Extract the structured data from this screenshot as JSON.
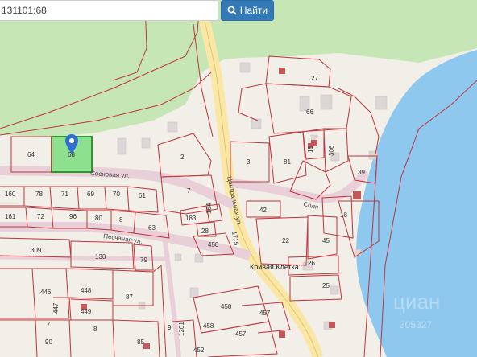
{
  "search": {
    "value": "131101:68",
    "button_label": "Найти"
  },
  "map": {
    "streets": [
      "Сосновая ул.",
      "Песчаная ул.",
      "Центральная ул.",
      "Солн",
      "Кривая Клетка"
    ],
    "parcels": [
      "64",
      "68",
      "160",
      "78",
      "71",
      "69",
      "70",
      "61",
      "161",
      "72",
      "96",
      "80",
      "8",
      "63",
      "183",
      "164",
      "28",
      "450",
      "309",
      "130",
      "79",
      "446",
      "448",
      "87",
      "447",
      "449",
      "7",
      "90",
      "8",
      "85",
      "9",
      "457",
      "458",
      "452",
      "458",
      "457",
      "1201",
      "2",
      "7",
      "3",
      "81",
      "15",
      "306",
      "39",
      "66",
      "27",
      "42",
      "18",
      "22",
      "45",
      "26",
      "25",
      "1715"
    ],
    "watermark": "циан",
    "watermark_sub": "305327"
  }
}
